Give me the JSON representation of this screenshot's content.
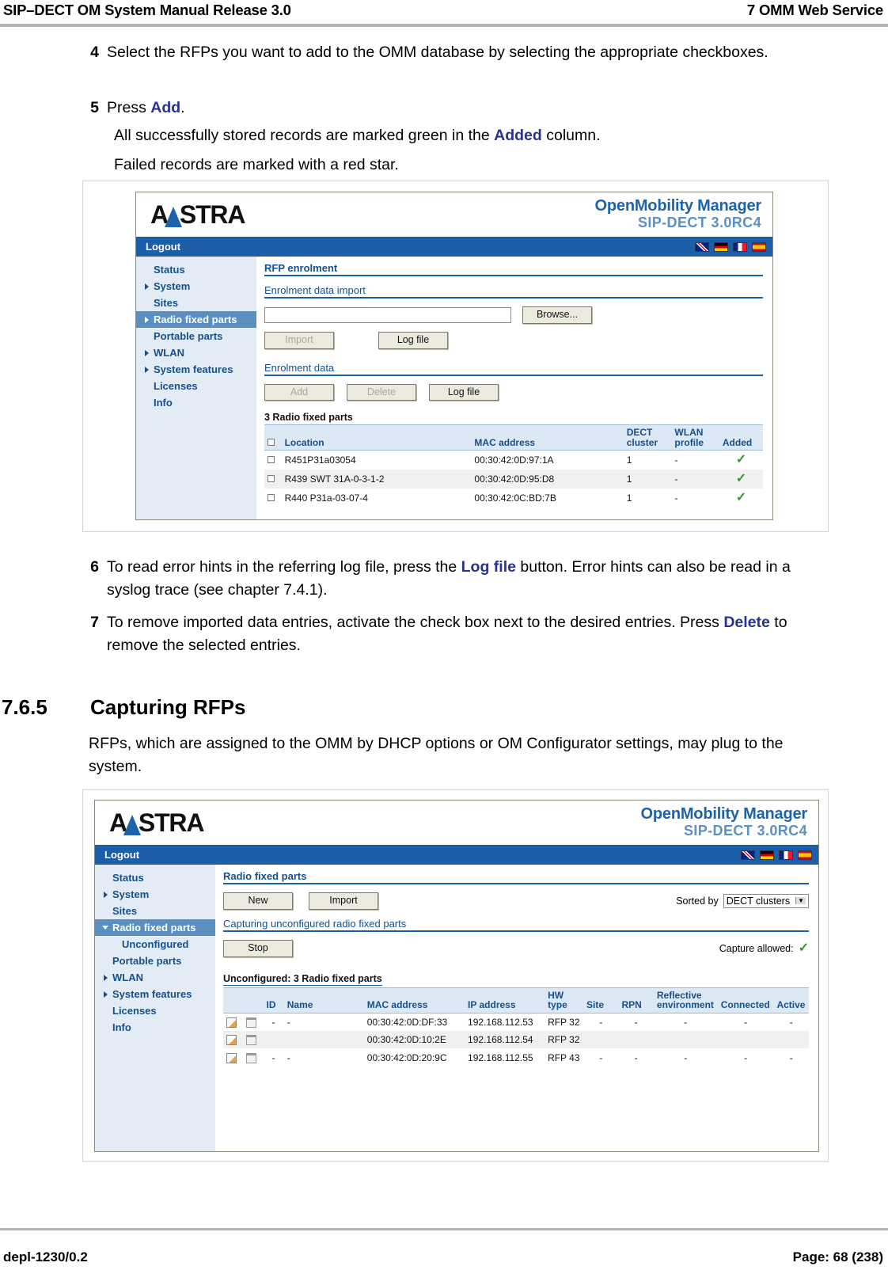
{
  "header": {
    "left": "SIP–DECT OM System Manual Release 3.0",
    "right": "7 OMM Web Service"
  },
  "footer": {
    "left": "depl-1230/0.2",
    "right": "Page: 68 (238)"
  },
  "steps": {
    "s4_num": "4",
    "s4_text": "Select the RFPs you want to add to the OMM database by selecting the appropriate checkboxes.",
    "s5_num": "5",
    "s5_pre": "Press ",
    "s5_bold": "Add",
    "s5_post": ".",
    "s5_sub1_pre": "All successfully stored records are marked green in the ",
    "s5_sub1_bold": "Added",
    "s5_sub1_post": " column.",
    "s5_sub2": "Failed records are marked with a red star.",
    "s6_num": "6",
    "s6_pre": "To read error hints in the referring log file, press the ",
    "s6_bold": "Log file",
    "s6_post": " button. Error hints can also be read in a syslog trace (see chapter 7.4.1).",
    "s7_num": "7",
    "s7_pre": "To remove imported data entries, activate the check box next to the desired entries. Press ",
    "s7_bold": "Delete",
    "s7_post": " to remove the selected entries."
  },
  "section": {
    "number": "7.6.5",
    "title": "Capturing RFPs",
    "paragraph": "RFPs, which are assigned to the OMM by DHCP options or OM Configurator settings, may plug to the system."
  },
  "shot1": {
    "brand": {
      "logo_a": "A",
      "logo_rest": "STRA",
      "title_line1": "OpenMobility Manager",
      "title_line2": "SIP-DECT 3.0RC4"
    },
    "bar": {
      "logout": "Logout"
    },
    "flags": [
      "uk-flag-icon",
      "germany-flag-icon",
      "france-flag-icon",
      "spain-flag-icon"
    ],
    "nav": [
      {
        "label": "Status",
        "arrow": "none",
        "selected": false,
        "indent": false
      },
      {
        "label": "System",
        "arrow": "right",
        "selected": false,
        "indent": false
      },
      {
        "label": "Sites",
        "arrow": "none",
        "selected": false,
        "indent": false
      },
      {
        "label": "Radio fixed parts",
        "arrow": "right",
        "selected": true,
        "indent": false
      },
      {
        "label": "Portable parts",
        "arrow": "none",
        "selected": false,
        "indent": false
      },
      {
        "label": "WLAN",
        "arrow": "right",
        "selected": false,
        "indent": false
      },
      {
        "label": "System features",
        "arrow": "right",
        "selected": false,
        "indent": false
      },
      {
        "label": "Licenses",
        "arrow": "none",
        "selected": false,
        "indent": false
      },
      {
        "label": "Info",
        "arrow": "none",
        "selected": false,
        "indent": false
      }
    ],
    "page_title": "RFP enrolment",
    "group1_title": "Enrolment data import",
    "file_input_value": "",
    "browse_label": "Browse...",
    "import_label": "Import",
    "logfile_label_1": "Log file",
    "group2_title": "Enrolment data",
    "add_label": "Add",
    "delete_label": "Delete",
    "logfile_label_2": "Log file",
    "table_caption": "3 Radio fixed parts",
    "columns": [
      "",
      "Location",
      "MAC address",
      "DECT cluster",
      "WLAN profile",
      "Added"
    ],
    "rows": [
      {
        "location": "R451P31a03054",
        "mac": "00:30:42:0D:97:1A",
        "cluster": "1",
        "wlan": "-",
        "added": "check"
      },
      {
        "location": "R439 SWT 31A-0-3-1-2",
        "mac": "00:30:42:0D:95:D8",
        "cluster": "1",
        "wlan": "-",
        "added": "check"
      },
      {
        "location": "R440 P31a-03-07-4",
        "mac": "00:30:42:0C:BD:7B",
        "cluster": "1",
        "wlan": "-",
        "added": "check"
      }
    ]
  },
  "shot2": {
    "brand": {
      "logo_a": "A",
      "logo_rest": "STRA",
      "title_line1": "OpenMobility Manager",
      "title_line2": "SIP-DECT 3.0RC4"
    },
    "bar": {
      "logout": "Logout"
    },
    "flags": [
      "uk-flag-icon",
      "germany-flag-icon",
      "france-flag-icon",
      "spain-flag-icon"
    ],
    "nav": [
      {
        "label": "Status",
        "arrow": "none",
        "selected": false,
        "indent": false
      },
      {
        "label": "System",
        "arrow": "right",
        "selected": false,
        "indent": false
      },
      {
        "label": "Sites",
        "arrow": "none",
        "selected": false,
        "indent": false
      },
      {
        "label": "Radio fixed parts",
        "arrow": "down",
        "selected": true,
        "indent": false
      },
      {
        "label": "Unconfigured",
        "arrow": "none",
        "selected": false,
        "indent": true
      },
      {
        "label": "Portable parts",
        "arrow": "none",
        "selected": false,
        "indent": false
      },
      {
        "label": "WLAN",
        "arrow": "right",
        "selected": false,
        "indent": false
      },
      {
        "label": "System features",
        "arrow": "right",
        "selected": false,
        "indent": false
      },
      {
        "label": "Licenses",
        "arrow": "none",
        "selected": false,
        "indent": false
      },
      {
        "label": "Info",
        "arrow": "none",
        "selected": false,
        "indent": false
      }
    ],
    "page_title": "Radio fixed parts",
    "new_label": "New",
    "import_label": "Import",
    "sorted_by_label": "Sorted by",
    "sorted_by_value": "DECT clusters",
    "group_title": "Capturing unconfigured radio fixed parts",
    "stop_label": "Stop",
    "capture_allowed_label": "Capture allowed:",
    "capture_allowed_value": "check",
    "table_caption": "Unconfigured: 3 Radio fixed parts",
    "columns": [
      "",
      "",
      "ID",
      "Name",
      "MAC address",
      "IP address",
      "HW type",
      "Site",
      "RPN",
      "Reflective environment",
      "Connected",
      "Active"
    ],
    "rows": [
      {
        "id": "-",
        "name": "-",
        "mac": "00:30:42:0D:DF:33",
        "ip": "192.168.112.53",
        "hw": "RFP 32",
        "site": "-",
        "rpn": "-",
        "refl": "-",
        "conn": "-",
        "active": "-"
      },
      {
        "id": "",
        "name": "",
        "mac": "00:30:42:0D:10:2E",
        "ip": "192.168.112.54",
        "hw": "RFP 32",
        "site": "",
        "rpn": "",
        "refl": "",
        "conn": "",
        "active": ""
      },
      {
        "id": "-",
        "name": "-",
        "mac": "00:30:42:0D:20:9C",
        "ip": "192.168.112.55",
        "hw": "RFP 43",
        "site": "-",
        "rpn": "-",
        "refl": "-",
        "conn": "-",
        "active": "-"
      }
    ],
    "row_icons": [
      "edit-pencil-icon",
      "delete-trash-icon"
    ]
  },
  "colors": {
    "accent_blue": "#1c5ea8",
    "link_blue": "#26348c",
    "nav_bg": "#e3ecf5",
    "nav_sel": "#5b8fc0",
    "check_green": "#2e9b27"
  }
}
